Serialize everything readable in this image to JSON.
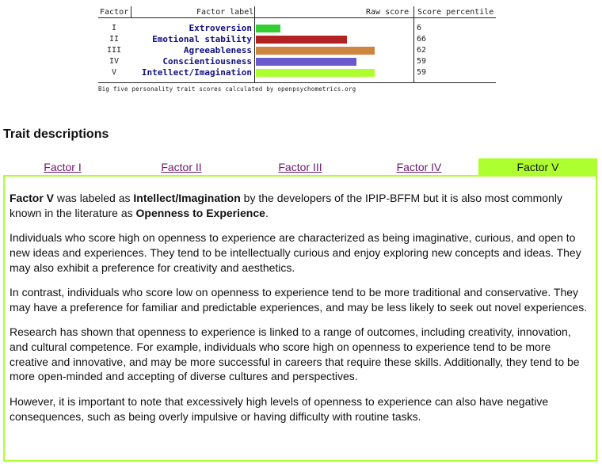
{
  "chart": {
    "headers": {
      "factor": "Factor",
      "label": "Factor label",
      "raw": "Raw score",
      "percentile": "Score percentile"
    },
    "rows": [
      {
        "roman": "I",
        "label": "Extroversion",
        "raw_fraction": 0.155,
        "percentile": "6",
        "color": "#32cd32"
      },
      {
        "roman": "II",
        "label": "Emotional stability",
        "raw_fraction": 0.575,
        "percentile": "66",
        "color": "#b22222"
      },
      {
        "roman": "III",
        "label": "Agreeableness",
        "raw_fraction": 0.75,
        "percentile": "62",
        "color": "#cd853f"
      },
      {
        "roman": "IV",
        "label": "Conscientiousness",
        "raw_fraction": 0.635,
        "percentile": "59",
        "color": "#6a5acd"
      },
      {
        "roman": "V",
        "label": "Intellect/Imagination",
        "raw_fraction": 0.75,
        "percentile": "59",
        "color": "#adff2f"
      }
    ],
    "caption": "Big five personality trait scores calculated by openpsychometrics.org"
  },
  "section": {
    "heading": "Trait descriptions"
  },
  "tabs": [
    {
      "label": "Factor I",
      "active": false
    },
    {
      "label": "Factor II",
      "active": false
    },
    {
      "label": "Factor III",
      "active": false
    },
    {
      "label": "Factor IV",
      "active": false
    },
    {
      "label": "Factor V",
      "active": true
    }
  ],
  "colors": {
    "accent": "#adff2f",
    "link": "#6a1b6a",
    "label_text": "#101080"
  },
  "panel": {
    "intro": {
      "factor": "Factor V",
      "t1": " was labeled as ",
      "name": "Intellect/Imagination",
      "t2": " by the developers of the IPIP-BFFM but it is also most commonly known in the literature as ",
      "alt": "Openness to Experience",
      "t3": "."
    },
    "paragraphs": [
      "Individuals who score high on openness to experience are characterized as being imaginative, curious, and open to new ideas and experiences. They tend to be intellectually curious and enjoy exploring new concepts and ideas. They may also exhibit a preference for creativity and aesthetics.",
      "In contrast, individuals who score low on openness to experience tend to be more traditional and conservative. They may have a preference for familiar and predictable experiences, and may be less likely to seek out novel experiences.",
      "Research has shown that openness to experience is linked to a range of outcomes, including creativity, innovation, and cultural competence. For example, individuals who score high on openness to experience tend to be more creative and innovative, and may be more successful in careers that require these skills. Additionally, they tend to be more open-minded and accepting of diverse cultures and perspectives.",
      "However, it is important to note that excessively high levels of openness to experience can also have negative consequences, such as being overly impulsive or having difficulty with routine tasks."
    ]
  }
}
